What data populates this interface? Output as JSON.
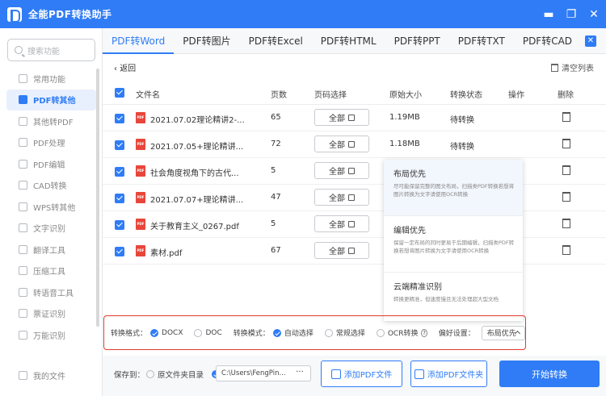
{
  "app": {
    "title": "全能PDF转换助手",
    "brand_color": "#2f7cf6"
  },
  "window": {
    "minimize": "▬",
    "restore": "❐",
    "close": "✕"
  },
  "sidebar": {
    "search_placeholder": "搜索功能",
    "items": [
      {
        "label": "常用功能",
        "icon": "star-icon"
      },
      {
        "label": "PDF转其他",
        "icon": "pdf-convert-icon",
        "active": true
      },
      {
        "label": "其他转PDF",
        "icon": "to-pdf-icon"
      },
      {
        "label": "PDF处理",
        "icon": "pdf-process-icon"
      },
      {
        "label": "PDF编辑",
        "icon": "pdf-edit-icon"
      },
      {
        "label": "CAD转换",
        "icon": "cad-icon"
      },
      {
        "label": "WPS转其他",
        "icon": "wps-icon"
      },
      {
        "label": "文字识别",
        "icon": "ocr-icon"
      },
      {
        "label": "翻译工具",
        "icon": "translate-icon"
      },
      {
        "label": "压缩工具",
        "icon": "compress-icon"
      },
      {
        "label": "转语音工具",
        "icon": "voice-icon"
      },
      {
        "label": "票证识别",
        "icon": "ticket-icon"
      },
      {
        "label": "万能识别",
        "icon": "universal-icon"
      }
    ],
    "my_files": "我的文件"
  },
  "tabs": [
    "PDF转Word",
    "PDF转图片",
    "PDF转Excel",
    "PDF转HTML",
    "PDF转PPT",
    "PDF转TXT",
    "PDF转CAD"
  ],
  "tab_close": "✕",
  "toolbar": {
    "back": "返回",
    "clear": "清空列表"
  },
  "table": {
    "headers": [
      "文件名",
      "页数",
      "页码选择",
      "原始大小",
      "转换状态",
      "操作",
      "删除"
    ],
    "rows": [
      {
        "name": "2021.07.02理论精讲2-...",
        "pages": "65",
        "range": "全部",
        "size": "1.19MB",
        "status": "待转换"
      },
      {
        "name": "2021.07.05+理论精讲...",
        "pages": "72",
        "range": "全部",
        "size": "1.18MB",
        "status": "待转换"
      },
      {
        "name": "社会角度视角下的古代...",
        "pages": "5",
        "range": "全部",
        "size": "",
        "status": ""
      },
      {
        "name": "2021.07.07+理论精讲...",
        "pages": "47",
        "range": "全部",
        "size": "",
        "status": ""
      },
      {
        "name": "关于教育主义_0267.pdf",
        "pages": "5",
        "range": "全部",
        "size": "",
        "status": ""
      },
      {
        "name": "素材.pdf",
        "pages": "67",
        "range": "全部",
        "size": "",
        "status": ""
      }
    ],
    "pdf_badge": "PDF"
  },
  "popup": {
    "options": [
      {
        "title": "布局优先",
        "desc": "尽可能保留完整的图文布局，扫描类PDF转换若想将图片转换为文字请使用OCR转换"
      },
      {
        "title": "编辑优先",
        "desc": "保留一定布局的同时更易于后期编辑，扫描类PDF转换若想将图片转换为文字请使用OCR转换"
      },
      {
        "title": "云端精准识别",
        "desc": "转换更精准，但速度慢且无法处理超大型文档"
      }
    ]
  },
  "options_bar": {
    "format_label": "转换格式：",
    "docx": "DOCX",
    "doc": "DOC",
    "mode_label": "转换模式：",
    "auto": "自动选择",
    "normal": "常规选择",
    "ocr": "OCR转换",
    "help": "?",
    "pref_label": "偏好设置：",
    "pref_value": "布局优先"
  },
  "footer": {
    "save_to": "保存到：",
    "orig_dir": "原文件夹目录",
    "path": "C:\\Users\\FengPin...",
    "browse": "···",
    "add_file": "添加PDF文件",
    "add_folder": "添加PDF文件夹",
    "start": "开始转换"
  }
}
